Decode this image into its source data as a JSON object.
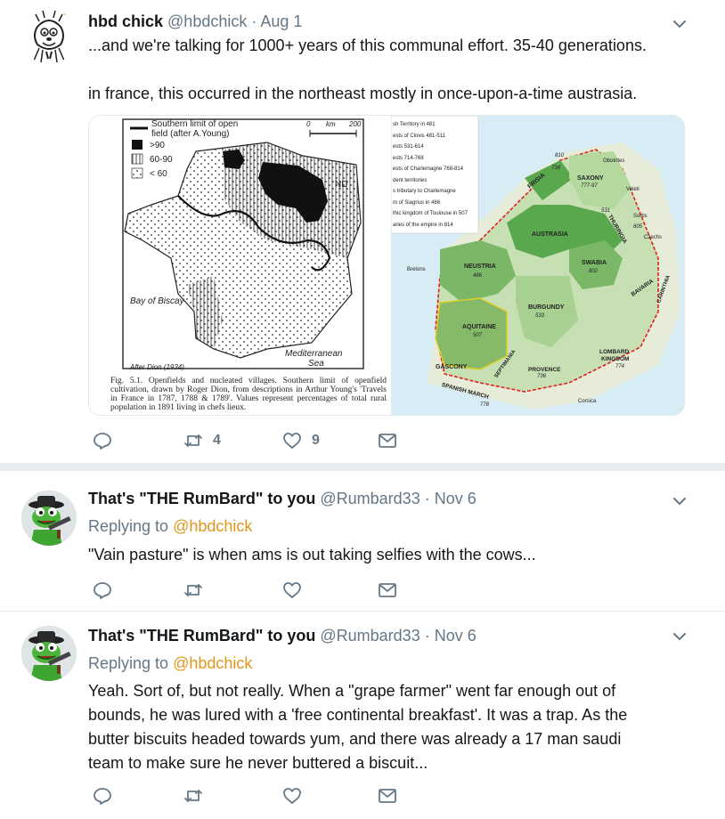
{
  "tweets": [
    {
      "name": "hbd chick",
      "handle": "@hbdchick",
      "sep": " · ",
      "time": "Aug 1",
      "paragraphs": [
        "...and we're talking for 1000+ years of this communal effort. 35-40 generations.",
        "in france, this occurred in the northeast mostly in once-upon-a-time austrasia."
      ],
      "actions": {
        "reply_count": "",
        "retweet_count": "4",
        "like_count": "9"
      }
    },
    {
      "name": "That's \"THE RumBard\" to you",
      "handle": "@Rumbard33",
      "sep": " · ",
      "time": "Nov 6",
      "replying_prefix": "Replying to ",
      "replying_to": "@hbdchick",
      "text": "\"Vain pasture\" is when ams is out taking selfies with the cows...",
      "actions": {
        "reply_count": "",
        "retweet_count": "",
        "like_count": ""
      }
    },
    {
      "name": "That's \"THE RumBard\" to you",
      "handle": "@Rumbard33",
      "sep": " · ",
      "time": "Nov 6",
      "replying_prefix": "Replying to ",
      "replying_to": "@hbdchick",
      "lines": [
        "Yeah. Sort of, but not really. When a \"grape farmer\" went far enough out of",
        "bounds, he was lured with a 'free continental breakfast'. It was a trap. As the",
        "butter biscuits headed towards yum, and there was already a 17 man saudi",
        "team to make sure he never buttered a biscuit..."
      ],
      "actions": {
        "reply_count": "",
        "retweet_count": "",
        "like_count": ""
      }
    }
  ],
  "media": {
    "left_map": {
      "legend_title_1": "Southern limit of open",
      "legend_title_2": "field (after A.Young)",
      "legend_gt90": ">90",
      "legend_60_90": "60-90",
      "legend_lt60": "< 60",
      "scale_0": "0",
      "scale_km": "km",
      "scale_200": "200",
      "nd_label": "ND",
      "biscay": "Bay of Biscay",
      "med_1": "Mediterranean",
      "med_2": "Sea",
      "after": "After Dion (1934)",
      "caption": "Fig. 5.1. Openfields and nucleated villages. Southern limit of openfield cultivation, drawn by Roger Dion, from descriptions in Arthur Young's 'Travels in France in 1787, 1788 & 1789'. Values represent percentages of total rural population in 1891 living in chefs lieux."
    },
    "right_map": {
      "legend": [
        "sh Territory in 481",
        "ests of Clovis 481-511",
        "ests 531-614",
        "ests 714-768",
        "ests of Charlemagne 768-814",
        "dent territories",
        "s tributary to Charlemagne",
        "m of Siagrius in 486",
        "thic kingdom of Toulouse in 507",
        "aries of the empire in 814"
      ],
      "regions": {
        "saxony": "SAXONY",
        "saxony_dates": "777-97",
        "frisia": "FRISIA",
        "austrasia": "AUSTRASIA",
        "neustria": "NEUSTRIA",
        "neustria_year": "486",
        "swabia": "SWABIA",
        "swabia_year": "802",
        "bavaria": "BAVARIA",
        "burgundy": "BURGUNDY",
        "burgundy_year": "533",
        "aquitaine": "AQUITAINE",
        "aquitaine_year": "507",
        "gascony": "GASCONY",
        "septimania": "SEPTIMANIA",
        "provence": "PROVENCE",
        "provence_year": "736",
        "lombard": "LOMBARD",
        "kingdom": "KINGDOM",
        "lombard_year": "774",
        "spanish_march": "SPANISH MARCH",
        "spanish_year": "778",
        "thuringia": "THURINGIA",
        "carinthia": "CARINTHIA",
        "bretons": "Bretons",
        "corsica": "Corsica",
        "year_810": "810",
        "year_734": "734",
        "year_805": "805",
        "year_531": "531",
        "czechs": "Czechs",
        "sorbs": "Sorbs",
        "veleti": "Veleti",
        "obotrites": "Obotrites"
      }
    }
  },
  "colors": {
    "text": "#14171a",
    "secondary": "#657786",
    "mention": "#e0961d",
    "divider": "#e6ecf0",
    "icon": "#657786"
  }
}
